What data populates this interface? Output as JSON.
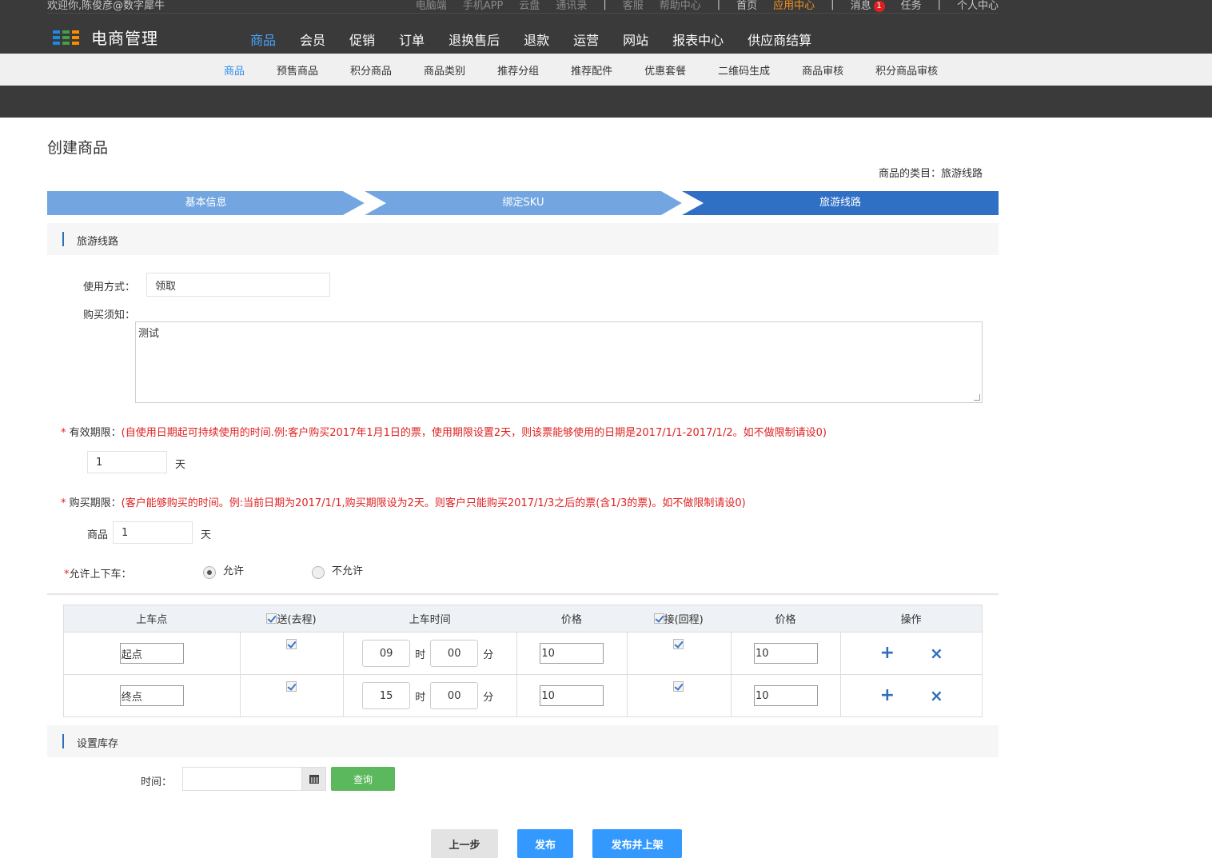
{
  "topbar": {
    "welcome": "欢迎你,陈俊彦@数字犀牛",
    "links_gray": [
      "电脑端",
      "手机APP",
      "云盘",
      "通讯录"
    ],
    "links_gray2": [
      "客服",
      "帮助中心"
    ],
    "home": "首页",
    "app_center": "应用中心",
    "messages": "消息",
    "messages_count": "1",
    "tasks": "任务",
    "personal": "个人中心",
    "separator": "|"
  },
  "logo": {
    "text": "电商管理"
  },
  "mainnav": [
    "商品",
    "会员",
    "促销",
    "订单",
    "退换售后",
    "退款",
    "运营",
    "网站",
    "报表中心",
    "供应商结算"
  ],
  "subnav": [
    "商品",
    "预售商品",
    "积分商品",
    "商品类别",
    "推荐分组",
    "推荐配件",
    "优惠套餐",
    "二维码生成",
    "商品审核",
    "积分商品审核"
  ],
  "page": {
    "title": "创建商品",
    "category_line": "商品的类目：旅游线路"
  },
  "steps": [
    "基本信息",
    "绑定SKU",
    "旅游线路"
  ],
  "section_route": {
    "title": "旅游线路"
  },
  "form": {
    "usage_label": "使用方式：",
    "usage_value": "领取",
    "notice_label": "购买须知：",
    "notice_value": "测试",
    "validity_star": "*",
    "validity_label": "有效期限：",
    "validity_hint": "(自使用日期起可持续使用的时间.例:客户购买2017年1月1日的票，使用期限设置2天，则该票能够使用的日期是2017/1/1-2017/1/2。如不做限制请设0)",
    "validity_value": "1",
    "validity_unit": "天",
    "purchase_star": "*",
    "purchase_label": "购买期限：",
    "purchase_hint": "(客户能够购买的时间。例:当前日期为2017/1/1,购买期限设为2天。则客户只能购买2017/1/3之后的票(含1/3的票)。如不做限制请设0)",
    "purchase_prefix": "商品",
    "purchase_value": "1",
    "purchase_unit": "天",
    "board_star": "*",
    "board_label": "允许上下车：",
    "allow": "允许",
    "disallow": "不允许"
  },
  "table": {
    "headers": [
      "上车点",
      "送(去程)",
      "上车时间",
      "价格",
      "接(回程)",
      "价格",
      "操作"
    ],
    "hour_unit": "时",
    "minute_unit": "分",
    "rows": [
      {
        "point": "起点",
        "hour": "09",
        "minute": "00",
        "price1": "10",
        "price2": "10"
      },
      {
        "point": "终点",
        "hour": "15",
        "minute": "00",
        "price1": "10",
        "price2": "10"
      }
    ]
  },
  "section_stock": {
    "title": "设置库存",
    "time_label": "时间：",
    "query": "查询"
  },
  "buttons": {
    "prev": "上一步",
    "publish": "发布",
    "publish_shelve": "发布并上架"
  },
  "colors": {
    "step_light": "#73a6e0",
    "step_active": "#2f6fc4",
    "accent": "#2d8cf0",
    "orange": "#f7931e",
    "green": "#5cb85c"
  }
}
